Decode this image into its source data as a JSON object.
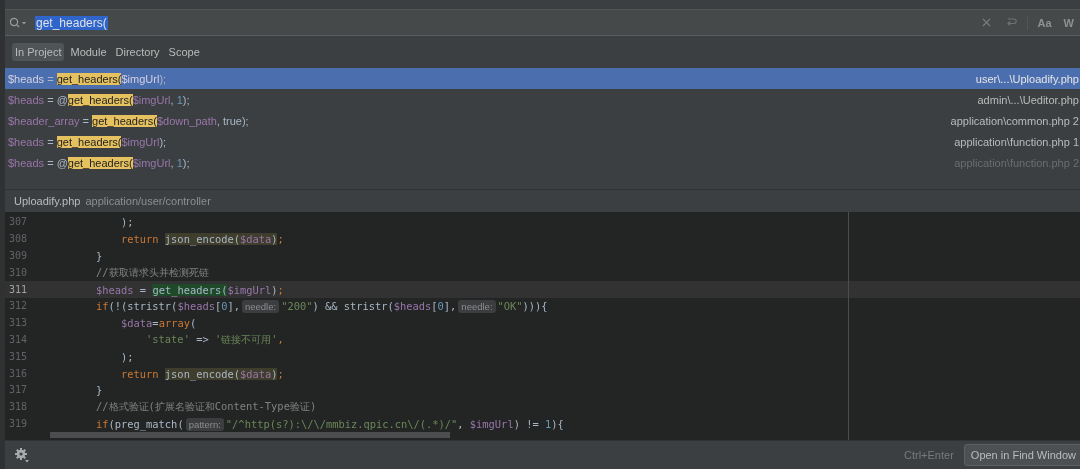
{
  "search": {
    "value": "get_headers(",
    "toggles": [
      "Aa",
      "W"
    ]
  },
  "scopes": [
    {
      "label": "In Project",
      "selected": true
    },
    {
      "label": "Module",
      "selected": false
    },
    {
      "label": "Directory",
      "selected": false
    },
    {
      "label": "Scope",
      "selected": false
    }
  ],
  "results": [
    {
      "selected": true,
      "dimmed": false,
      "file": "user\\...\\Uploadify.php",
      "parts": [
        {
          "t": "$heads",
          "kind": "var"
        },
        {
          "t": " = ",
          "kind": "plain"
        },
        {
          "t": "get_headers(",
          "kind": "match"
        },
        {
          "t": "$imgUrl",
          "kind": "var"
        },
        {
          "t": ");",
          "kind": "plain"
        }
      ]
    },
    {
      "selected": false,
      "dimmed": false,
      "file": "admin\\...\\Ueditor.php",
      "parts": [
        {
          "t": "$heads",
          "kind": "var"
        },
        {
          "t": " = @",
          "kind": "plain"
        },
        {
          "t": "get_headers(",
          "kind": "match"
        },
        {
          "t": "$imgUrl",
          "kind": "var"
        },
        {
          "t": ", ",
          "kind": "plain"
        },
        {
          "t": "1",
          "kind": "number"
        },
        {
          "t": ");",
          "kind": "plain"
        }
      ]
    },
    {
      "selected": false,
      "dimmed": false,
      "file": "application\\common.php 2",
      "parts": [
        {
          "t": "$header_array",
          "kind": "var"
        },
        {
          "t": " = ",
          "kind": "plain"
        },
        {
          "t": "get_headers(",
          "kind": "match"
        },
        {
          "t": "$down_path",
          "kind": "var"
        },
        {
          "t": ", true);",
          "kind": "plain"
        }
      ]
    },
    {
      "selected": false,
      "dimmed": false,
      "file": "application\\function.php 1",
      "parts": [
        {
          "t": "$heads",
          "kind": "var"
        },
        {
          "t": " = ",
          "kind": "plain"
        },
        {
          "t": "get_headers(",
          "kind": "match"
        },
        {
          "t": "$imgUrl",
          "kind": "var"
        },
        {
          "t": ");",
          "kind": "plain"
        }
      ]
    },
    {
      "selected": false,
      "dimmed": true,
      "file": "application\\function.php 2",
      "parts": [
        {
          "t": "$heads",
          "kind": "var"
        },
        {
          "t": " = @",
          "kind": "plain"
        },
        {
          "t": "get_headers(",
          "kind": "match"
        },
        {
          "t": "$imgUrl",
          "kind": "var"
        },
        {
          "t": ", ",
          "kind": "plain"
        },
        {
          "t": "1",
          "kind": "number"
        },
        {
          "t": ");",
          "kind": "plain"
        }
      ]
    }
  ],
  "preview": {
    "file": "Uploadify.php",
    "path": "application/user/controller"
  },
  "code": [
    {
      "n": "307",
      "current": false,
      "tokens": [
        {
          "t": "            );",
          "kind": "plain"
        }
      ]
    },
    {
      "n": "308",
      "current": false,
      "tokens": [
        {
          "t": "            return ",
          "kind": "keyword"
        },
        {
          "kind": "usage",
          "tokens": [
            {
              "t": "json_encode(",
              "kind": "plain"
            },
            {
              "t": "$data",
              "kind": "var"
            },
            {
              "t": ")",
              "kind": "plain"
            }
          ]
        },
        {
          "t": ";",
          "kind": "keyword"
        }
      ]
    },
    {
      "n": "309",
      "current": false,
      "tokens": [
        {
          "t": "        }",
          "kind": "plain"
        }
      ]
    },
    {
      "n": "310",
      "current": false,
      "tokens": [
        {
          "t": "        //获取请求头并检测死链",
          "kind": "comment"
        }
      ]
    },
    {
      "n": "311",
      "current": true,
      "tokens": [
        {
          "t": "        $heads",
          "kind": "var"
        },
        {
          "t": " = ",
          "kind": "plain"
        },
        {
          "kind": "found",
          "tokens": [
            {
              "t": "get_headers(",
              "kind": "plain"
            }
          ]
        },
        {
          "t": "$imgUrl",
          "kind": "var"
        },
        {
          "t": ")",
          "kind": "plain"
        },
        {
          "t": ";",
          "kind": "keyword"
        }
      ]
    },
    {
      "n": "312",
      "current": false,
      "tokens": [
        {
          "t": "        if",
          "kind": "keyword"
        },
        {
          "t": "(!(stristr(",
          "kind": "plain"
        },
        {
          "t": "$heads",
          "kind": "var"
        },
        {
          "t": "[",
          "kind": "plain"
        },
        {
          "t": "0",
          "kind": "number"
        },
        {
          "t": "],",
          "kind": "plain"
        },
        {
          "t": "needle:",
          "kind": "hint"
        },
        {
          "t": "\"200\"",
          "kind": "string"
        },
        {
          "t": ") && stristr(",
          "kind": "plain"
        },
        {
          "t": "$heads",
          "kind": "var"
        },
        {
          "t": "[",
          "kind": "plain"
        },
        {
          "t": "0",
          "kind": "number"
        },
        {
          "t": "],",
          "kind": "plain"
        },
        {
          "t": "needle:",
          "kind": "hint"
        },
        {
          "t": "\"OK\"",
          "kind": "string"
        },
        {
          "t": "))){",
          "kind": "plain"
        }
      ]
    },
    {
      "n": "313",
      "current": false,
      "tokens": [
        {
          "t": "            $data",
          "kind": "var"
        },
        {
          "t": "=",
          "kind": "plain"
        },
        {
          "t": "array",
          "kind": "keyword"
        },
        {
          "t": "(",
          "kind": "plain"
        }
      ]
    },
    {
      "n": "314",
      "current": false,
      "tokens": [
        {
          "t": "                'state'",
          "kind": "string"
        },
        {
          "t": " => ",
          "kind": "plain"
        },
        {
          "t": "'链接不可用'",
          "kind": "string"
        },
        {
          "t": ",",
          "kind": "keyword"
        }
      ]
    },
    {
      "n": "315",
      "current": false,
      "tokens": [
        {
          "t": "            );",
          "kind": "plain"
        }
      ]
    },
    {
      "n": "316",
      "current": false,
      "tokens": [
        {
          "t": "            return ",
          "kind": "keyword"
        },
        {
          "kind": "usage",
          "tokens": [
            {
              "t": "json_encode(",
              "kind": "plain"
            },
            {
              "t": "$data",
              "kind": "var"
            },
            {
              "t": ")",
              "kind": "plain"
            }
          ]
        },
        {
          "t": ";",
          "kind": "keyword"
        }
      ]
    },
    {
      "n": "317",
      "current": false,
      "tokens": [
        {
          "t": "        }",
          "kind": "plain"
        }
      ]
    },
    {
      "n": "318",
      "current": false,
      "tokens": [
        {
          "t": "        //格式验证(扩展名验证和Content-Type验证)",
          "kind": "comment"
        }
      ]
    },
    {
      "n": "319",
      "current": false,
      "tokens": [
        {
          "t": "        if",
          "kind": "keyword"
        },
        {
          "t": "(preg_match(",
          "kind": "plain"
        },
        {
          "t": "pattern:",
          "kind": "hint"
        },
        {
          "t": "\"/^http(s?):\\/\\/mmbiz.qpic.cn\\/(.*)/\"",
          "kind": "string"
        },
        {
          "t": ", ",
          "kind": "plain"
        },
        {
          "t": "$imgUrl",
          "kind": "var"
        },
        {
          "t": ") != ",
          "kind": "plain"
        },
        {
          "t": "1",
          "kind": "number"
        },
        {
          "t": "){",
          "kind": "plain"
        }
      ]
    }
  ],
  "footer": {
    "shortcut": "Ctrl+Enter",
    "button": "Open in Find Window"
  }
}
